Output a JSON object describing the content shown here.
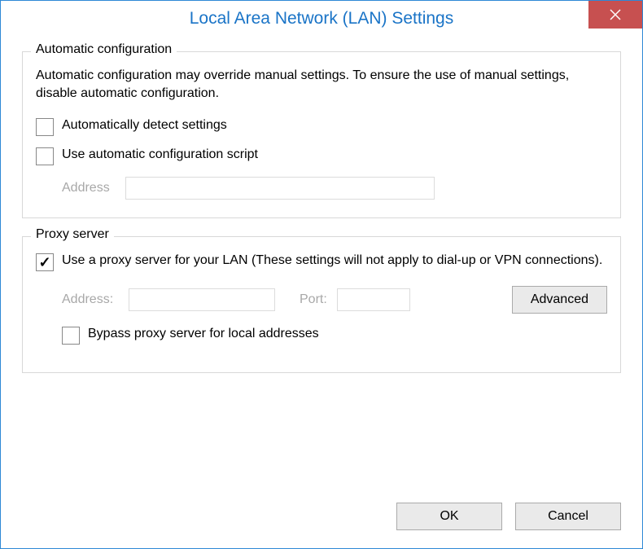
{
  "titlebar": {
    "title": "Local Area Network (LAN) Settings"
  },
  "autoConfig": {
    "legend": "Automatic configuration",
    "description": "Automatic configuration may override manual settings.  To ensure the use of manual settings, disable automatic configuration.",
    "detectLabel": "Automatically detect settings",
    "detectChecked": false,
    "scriptLabel": "Use automatic configuration script",
    "scriptChecked": false,
    "addressLabel": "Address",
    "addressValue": ""
  },
  "proxy": {
    "legend": "Proxy server",
    "useProxyLabel": "Use a proxy server for your LAN (These settings will not apply to dial-up or VPN connections).",
    "useProxyChecked": true,
    "addressLabel": "Address:",
    "addressValue": "",
    "portLabel": "Port:",
    "portValue": "",
    "advancedLabel": "Advanced",
    "bypassLabel": "Bypass proxy server for local addresses",
    "bypassChecked": false
  },
  "buttons": {
    "ok": "OK",
    "cancel": "Cancel"
  }
}
